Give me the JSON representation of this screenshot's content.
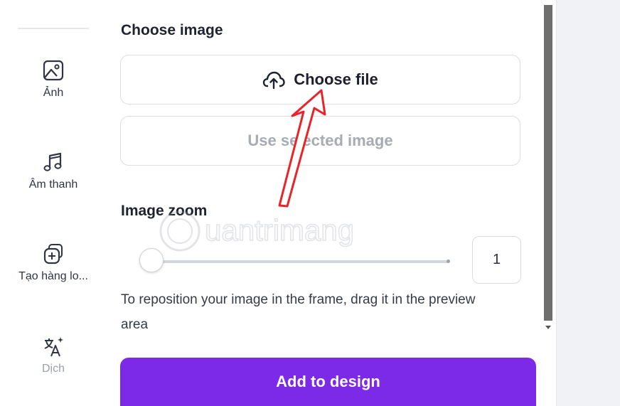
{
  "sidebar": {
    "items": [
      {
        "label": "Ảnh",
        "icon": "image-icon"
      },
      {
        "label": "Âm thanh",
        "icon": "music-icon"
      },
      {
        "label": "Tạo hàng lo...",
        "icon": "batch-create-icon"
      },
      {
        "label": "Dịch",
        "icon": "translate-icon"
      }
    ]
  },
  "panel": {
    "choose_image_title": "Choose image",
    "choose_file_label": "Choose file",
    "use_selected_label": "Use selected image",
    "image_zoom_title": "Image zoom",
    "zoom_value": "1",
    "zoom_level": 1,
    "hint": "To reposition your image in the frame, drag it in the preview area",
    "add_button_label": "Add to design"
  },
  "watermark": "uantrimang",
  "colors": {
    "accent": "#7d2ae8",
    "annotation_arrow": "#e8242a"
  }
}
